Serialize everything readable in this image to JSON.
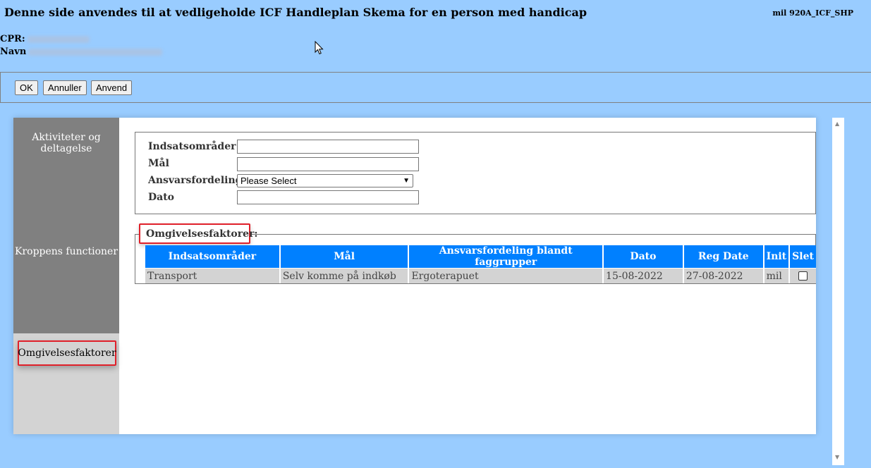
{
  "header": {
    "title": "Denne side anvendes til at vedligeholde ICF Handleplan Skema for en person med handicap",
    "screen_code": "mil 920A_ICF_SHP"
  },
  "person": {
    "cpr_label": "CPR:",
    "name_label": "Navn"
  },
  "toolbar": {
    "ok_label": "OK",
    "cancel_label": "Annuller",
    "apply_label": "Anvend"
  },
  "nav": {
    "activities": "Aktiviteter og deltagelse",
    "body_functions": "Kroppens functioner",
    "environment": "Omgivelsesfaktorer"
  },
  "form": {
    "focus_area_label": "Indsatsområder",
    "goal_label": "Mål",
    "responsibility_label": "Ansvarsfordeling",
    "responsibility_selected": "Please Select",
    "date_label": "Dato",
    "focus_area_value": "",
    "goal_value": "",
    "date_value": ""
  },
  "environment": {
    "legend": "Omgivelsesfaktorer:",
    "columns": [
      "Indsatsområder",
      "Mål",
      "Ansvarsfordeling blandt faggrupper",
      "Dato",
      "Reg Date",
      "Init",
      "Slet"
    ],
    "rows": [
      [
        "Transport",
        "Selv komme på indkøb",
        "Ergoterapuet",
        "15-08-2022",
        "27-08-2022",
        "mil"
      ]
    ]
  }
}
